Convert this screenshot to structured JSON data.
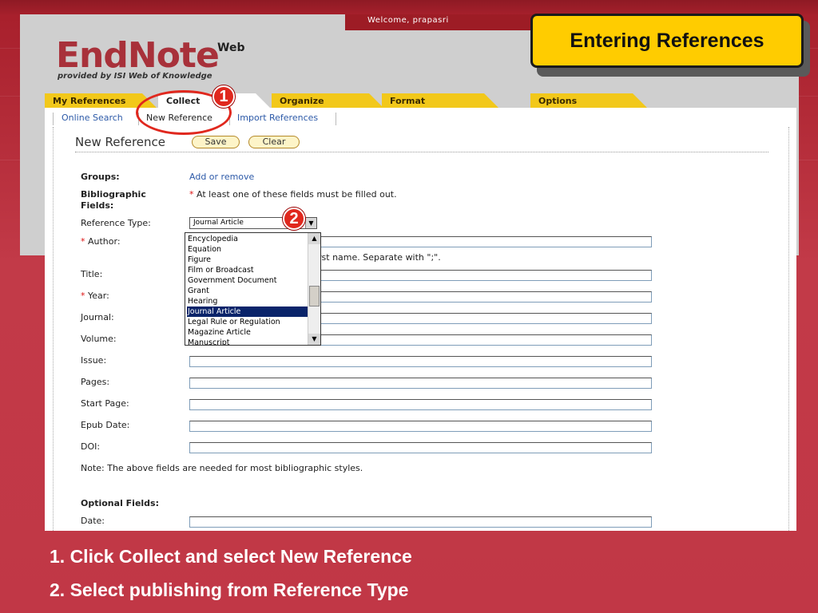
{
  "app": {
    "welcome": "Welcome, prapasri",
    "logo": "EndNote",
    "logo_superscript": "Web",
    "logo_tagline": "provided by ISI Web of Knowledge"
  },
  "tabs": [
    {
      "label": "My References",
      "active": false
    },
    {
      "label": "Collect",
      "active": true
    },
    {
      "label": "Organize",
      "active": false
    },
    {
      "label": "Format",
      "active": false
    },
    {
      "label": "Options",
      "active": false
    }
  ],
  "subnav": [
    {
      "label": "Online Search",
      "active": false
    },
    {
      "label": "New Reference",
      "active": true
    },
    {
      "label": "Import References",
      "active": false
    }
  ],
  "form": {
    "title": "New Reference",
    "save_label": "Save",
    "clear_label": "Clear",
    "groups_label": "Groups:",
    "groups_link": "Add or remove",
    "biblio_label": "Bibliographic Fields:",
    "required_note": "At least one of these fields must be filled out.",
    "reftype_label": "Reference Type:",
    "reftype_value": "Journal Article",
    "author_label": "Author:",
    "author_hint": "rst name. Separate with \";\".",
    "title_label": "Title:",
    "year_label": "Year:",
    "journal_label": "Journal:",
    "volume_label": "Volume:",
    "issue_label": "Issue:",
    "pages_label": "Pages:",
    "start_page_label": "Start Page:",
    "epub_date_label": "Epub Date:",
    "doi_label": "DOI:",
    "bottom_note": "Note: The above fields are needed for most bibliographic styles.",
    "optional_label": "Optional Fields:",
    "date_label": "Date:"
  },
  "dropdown": {
    "options": [
      "Encyclopedia",
      "Equation",
      "Figure",
      "Film or Broadcast",
      "Government Document",
      "Grant",
      "Hearing",
      "Journal Article",
      "Legal Rule or Regulation",
      "Magazine Article",
      "Manuscript"
    ],
    "selected": "Journal Article"
  },
  "callout": {
    "title": "Entering References"
  },
  "markers": {
    "one": "1",
    "two": "2"
  },
  "instructions": {
    "step1": "1. Click  Collect and select New Reference",
    "step2": "2. Select publishing from Reference Type"
  },
  "colors": {
    "background": "#b32a38",
    "tab_yellow": "#f2c81a",
    "callout_yellow": "#ffcc00",
    "marker_red": "#e0281e",
    "selection_blue": "#0a246a",
    "link_blue": "#2d5aa8"
  }
}
